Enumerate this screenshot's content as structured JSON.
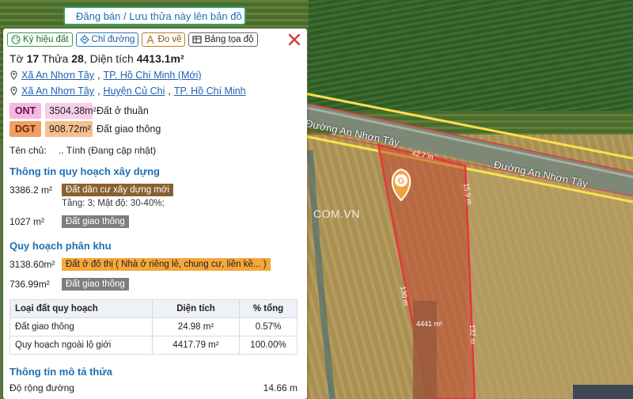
{
  "banner": {
    "text": "Đăng bán / Lưu thửa này lên bản đồ"
  },
  "toolbar": {
    "symbol": "Ký hiệu đất",
    "directions": "Chỉ đường",
    "measure": "Đo vẽ",
    "coords": "Bảng tọa độ"
  },
  "parcel": {
    "sheet_label": "Tờ",
    "sheet": "17",
    "plot_label": "Thửa",
    "plot": "28",
    "area_label": "Diện tích",
    "area": "4413.1m²",
    "addr1": {
      "commune": "Xã An Nhơn Tây",
      "city": "TP. Hồ Chí Minh (Mới)"
    },
    "addr2": {
      "commune": "Xã An Nhơn Tây",
      "district": "Huyện Củ Chi",
      "city": "TP. Hồ Chí Minh"
    }
  },
  "zones": [
    {
      "code": "ONT",
      "area": "3504.38m²",
      "desc": "Đất ở thuần"
    },
    {
      "code": "DGT",
      "area": "908.72m²",
      "desc": "Đất giao thông"
    }
  ],
  "owner": {
    "label": "Tên chủ:",
    "value": ".. Tính (Đang cập nhật)"
  },
  "construction": {
    "title": "Thông tin quy hoạch xây dựng",
    "rows": [
      {
        "area": "3386.2 m²",
        "tag": "Đất dân cư xây dựng mới",
        "detail": "Tầng: 3; Mật độ: 30-40%;"
      },
      {
        "area": "1027 m²",
        "tag": "Đất giao thông"
      }
    ]
  },
  "subdivision": {
    "title": "Quy hoạch phân khu",
    "rows": [
      {
        "area": "3138.60m²",
        "tag": "Đất ở đô thị ( Nhà ở riêng lẻ, chung cư, liền kề... )"
      },
      {
        "area": "736.99m²",
        "tag": "Đất giao thông"
      }
    ]
  },
  "table": {
    "headers": [
      "Loại đất quy hoạch",
      "Diện tích",
      "% tổng"
    ],
    "rows": [
      [
        "Đất giao thông",
        "24.98 m²",
        "0.57%"
      ],
      [
        "Quy hoạch ngoài lộ giới",
        "4417.79 m²",
        "100.00%"
      ]
    ]
  },
  "description": {
    "title": "Thông tin mô tả thửa",
    "road_width_label": "Độ rộng đường",
    "road_width": "14.66 m"
  },
  "map": {
    "road_name": "Đường An Nhơn Tây",
    "road_name_2": "Đường An Nhơn Tây",
    "watermark": "COM.VN",
    "edge_top": "42.7 m",
    "edge_right_top": "15.9 m",
    "edge_left": "130 m",
    "edge_right": "132 m",
    "parcel_area": "4441 m²",
    "marker_letter": "G"
  },
  "colors": {
    "parcel_outline": "#e8343c",
    "road_outline": "#ffe04a",
    "accent": "#1f6fb2"
  }
}
